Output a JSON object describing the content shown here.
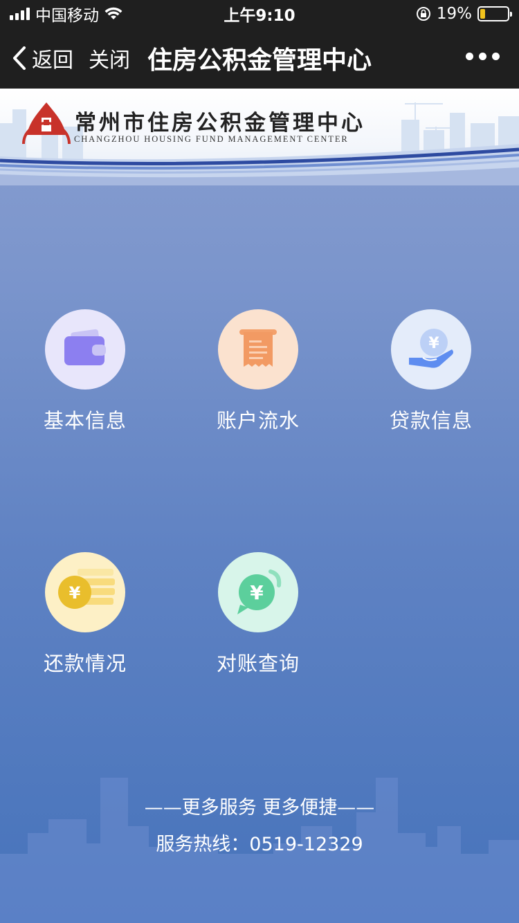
{
  "status_bar": {
    "carrier": "中国移动",
    "time": "上午9:10",
    "battery": "19%",
    "battery_level": 0.19
  },
  "nav": {
    "back_label": "返回",
    "close_label": "关闭",
    "title": "住房公积金管理中心"
  },
  "banner": {
    "title_cn": "常州市住房公积金管理中心",
    "title_en": "CHANGZHOU HOUSING FUND MANAGEMENT CENTER"
  },
  "menu": [
    {
      "label": "基本信息",
      "icon": "wallet-icon",
      "bg": "#e8e6fb"
    },
    {
      "label": "账户流水",
      "icon": "receipt-icon",
      "bg": "#fbe2cf"
    },
    {
      "label": "贷款信息",
      "icon": "loan-hand-icon",
      "bg": "#e4ecfa"
    },
    {
      "label": "还款情况",
      "icon": "coins-icon",
      "bg": "#fdf0c6"
    },
    {
      "label": "对账查询",
      "icon": "yuan-chat-icon",
      "bg": "#d8f5ea"
    }
  ],
  "footer": {
    "slogan": "——更多服务 更多便捷——",
    "hotline": "服务热线：0519-12329"
  }
}
